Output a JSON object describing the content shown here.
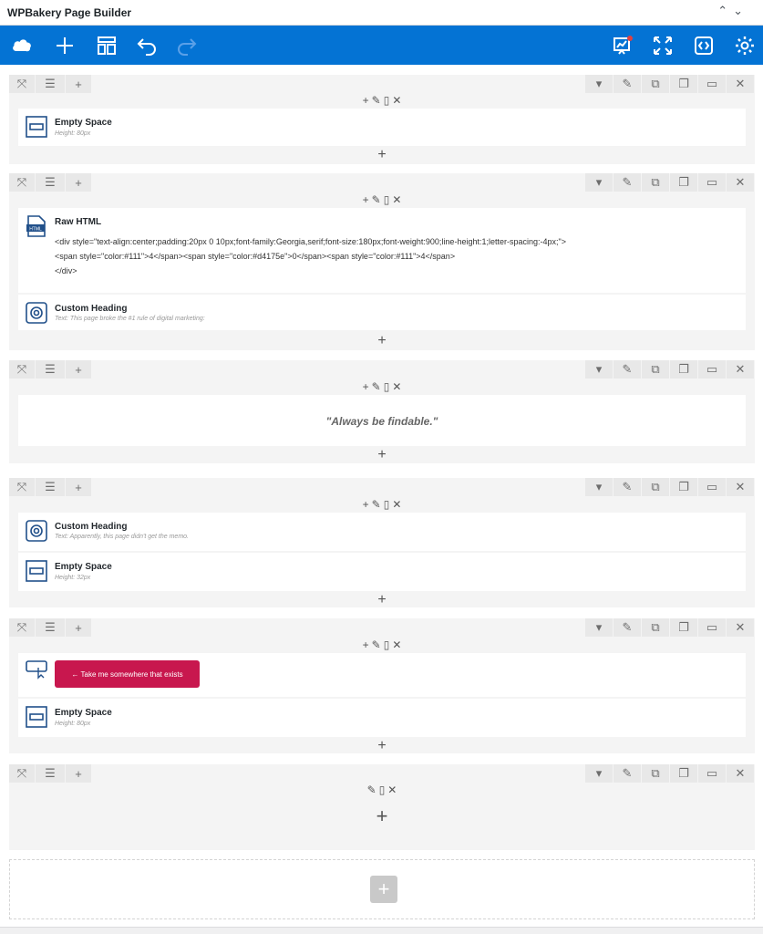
{
  "window": {
    "title": "WPBakery Page Builder"
  },
  "toolbar": {
    "icons": [
      "wpbakery-logo-icon",
      "add-element-icon",
      "templates-icon",
      "undo-icon",
      "redo-icon",
      "seo-icon",
      "fullscreen-icon",
      "custom-css-icon",
      "settings-icon"
    ],
    "accent_color": "#0473d4",
    "notification_color": "#e04040"
  },
  "rows": [
    {
      "elements": [
        {
          "name": "Empty Space",
          "param": "Height: 80px"
        }
      ]
    },
    {
      "elements": [
        {
          "name": "Raw HTML",
          "code": "<div style=\"text-align:center;padding:20px 0 10px;font-family:Georgia,serif;font-size:180px;font-weight:900;line-height:1;letter-spacing:-4px;\">\n<span style=\"color:#111\">4</span><span style=\"color:#d4175e\">0</span><span style=\"color:#111\">4</span>\n</div>"
        },
        {
          "name": "Custom Heading",
          "param": "Text: This page broke the #1 rule of digital marketing:"
        }
      ]
    },
    {
      "elements": [
        {
          "quote": "\"Always be findable.\""
        }
      ]
    },
    {
      "elements": [
        {
          "name": "Custom Heading",
          "param": "Text: Apparently, this page didn't get the memo."
        },
        {
          "name": "Empty Space",
          "param": "Height: 32px"
        }
      ]
    },
    {
      "elements": [
        {
          "button_label": "← Take me somewhere that exists"
        },
        {
          "name": "Empty Space",
          "param": "Height: 80px"
        }
      ]
    },
    {
      "elements": []
    }
  ],
  "button_color": "#c8174e",
  "icons": {
    "row_left": [
      "move-arrows-icon",
      "layout-lines-icon",
      "add-column-icon"
    ],
    "row_right": [
      "dropdown-icon",
      "edit-icon",
      "clone-icon",
      "copy-icon",
      "paste-icon",
      "delete-icon"
    ],
    "column": [
      "add-icon",
      "edit-pencil-icon",
      "paste-icon",
      "close-icon"
    ]
  }
}
